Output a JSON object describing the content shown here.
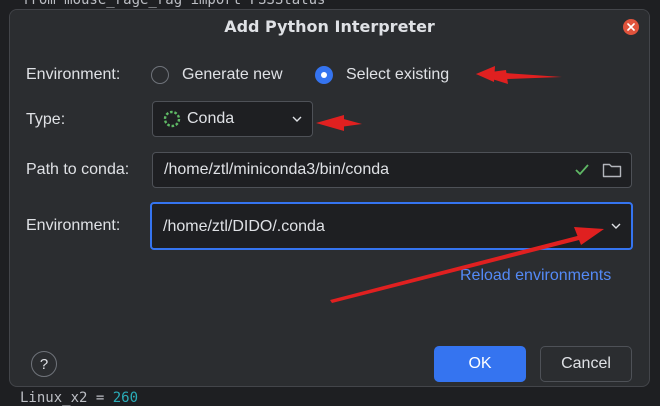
{
  "background": {
    "top_code": "from mouse_rage_rag import FSSStatus",
    "bottom_code_prefix": "Linux_x2  = ",
    "bottom_code_number": "260"
  },
  "dialog": {
    "title": "Add Python Interpreter"
  },
  "environment_mode": {
    "label": "Environment:",
    "options": [
      {
        "label": "Generate new",
        "selected": false
      },
      {
        "label": "Select existing",
        "selected": true
      }
    ]
  },
  "type": {
    "label": "Type:",
    "value": "Conda"
  },
  "path": {
    "label": "Path to conda:",
    "value": "/home/ztl/miniconda3/bin/conda"
  },
  "environment": {
    "label": "Environment:",
    "value": "/home/ztl/DIDO/.conda"
  },
  "reload_link": "Reload environments",
  "buttons": {
    "help": "?",
    "ok": "OK",
    "cancel": "Cancel"
  },
  "colors": {
    "accent": "#3574f0",
    "link": "#548af7",
    "check": "#5fb865",
    "annotation_arrow": "#e02020",
    "close": "#e0533c"
  },
  "icons": {
    "close": "close-icon",
    "conda": "conda-spinner-icon",
    "check": "check-icon",
    "folder": "folder-icon",
    "chevron": "chevron-down-icon",
    "help": "help-icon"
  }
}
